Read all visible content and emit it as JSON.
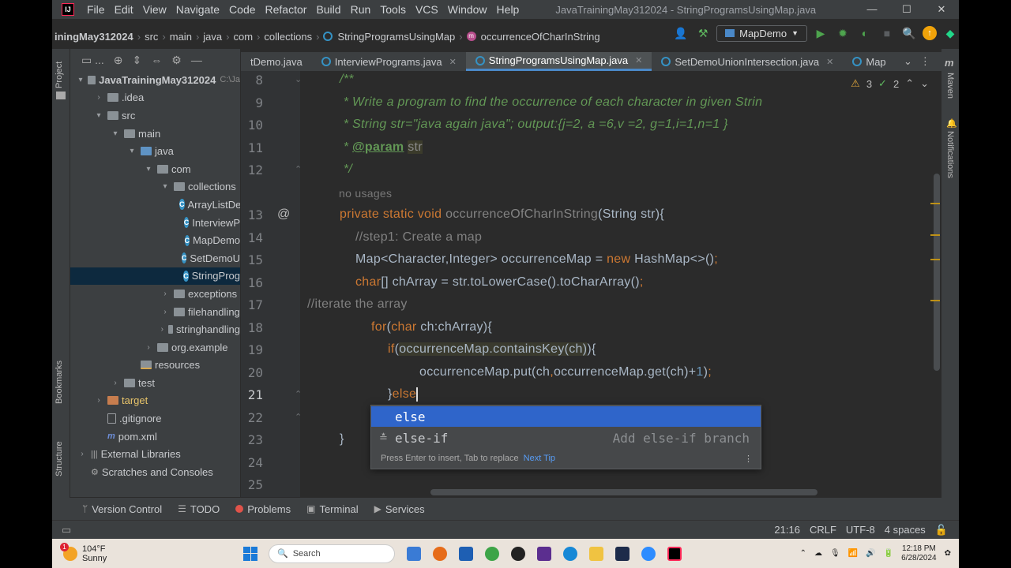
{
  "window": {
    "title": "JavaTrainingMay312024 - StringProgramsUsingMap.java",
    "menu": [
      "File",
      "Edit",
      "View",
      "Navigate",
      "Code",
      "Refactor",
      "Build",
      "Run",
      "Tools",
      "VCS",
      "Window",
      "Help"
    ],
    "controls": [
      "—",
      "☐",
      "✕"
    ]
  },
  "breadcrumb": [
    "iningMay312024",
    "src",
    "main",
    "java",
    "com",
    "collections",
    "StringProgramsUsingMap",
    "occurrenceOfCharInString"
  ],
  "run_config": "MapDemo",
  "tool_strip_left": [
    "Project",
    "Bookmarks",
    "Structure"
  ],
  "tool_strip_right": [
    "Maven",
    "Notifications"
  ],
  "project": {
    "toolbar_label": "...",
    "tree": [
      {
        "label": "JavaTrainingMay312024",
        "suffix": "C:\\Ja",
        "depth": 0,
        "chev": "▾",
        "icon": "folder"
      },
      {
        "label": ".idea",
        "depth": 1,
        "chev": "›",
        "icon": "folder"
      },
      {
        "label": "src",
        "depth": 1,
        "chev": "▾",
        "icon": "folder"
      },
      {
        "label": "main",
        "depth": 2,
        "chev": "▾",
        "icon": "folder"
      },
      {
        "label": "java",
        "depth": 3,
        "chev": "▾",
        "icon": "src"
      },
      {
        "label": "com",
        "depth": 4,
        "chev": "▾",
        "icon": "folder"
      },
      {
        "label": "collections",
        "depth": 5,
        "chev": "▾",
        "icon": "folder"
      },
      {
        "label": "ArrayListDe",
        "depth": 6,
        "chev": "",
        "icon": "class"
      },
      {
        "label": "InterviewP",
        "depth": 6,
        "chev": "",
        "icon": "class"
      },
      {
        "label": "MapDemo",
        "depth": 6,
        "chev": "",
        "icon": "class"
      },
      {
        "label": "SetDemoU",
        "depth": 6,
        "chev": "",
        "icon": "class"
      },
      {
        "label": "StringProg",
        "depth": 6,
        "chev": "",
        "icon": "class",
        "selected": true
      },
      {
        "label": "exceptions",
        "depth": 5,
        "chev": "›",
        "icon": "folder"
      },
      {
        "label": "filehandling",
        "depth": 5,
        "chev": "›",
        "icon": "folder"
      },
      {
        "label": "stringhandling",
        "depth": 5,
        "chev": "›",
        "icon": "folder"
      },
      {
        "label": "org.example",
        "depth": 4,
        "chev": "›",
        "icon": "folder"
      },
      {
        "label": "resources",
        "depth": 3,
        "chev": "",
        "icon": "res"
      },
      {
        "label": "test",
        "depth": 2,
        "chev": "›",
        "icon": "folder"
      },
      {
        "label": "target",
        "depth": 1,
        "chev": "›",
        "icon": "target",
        "hl": true
      },
      {
        "label": ".gitignore",
        "depth": 1,
        "chev": "",
        "icon": "file"
      },
      {
        "label": "pom.xml",
        "depth": 1,
        "chev": "",
        "icon": "pom"
      },
      {
        "label": "External Libraries",
        "depth": 0,
        "chev": "›",
        "icon": "lib"
      },
      {
        "label": "Scratches and Consoles",
        "depth": 0,
        "chev": "",
        "icon": "scratch"
      }
    ]
  },
  "tabs": [
    {
      "label": "tDemo.java",
      "active": false
    },
    {
      "label": "InterviewPrograms.java",
      "active": false
    },
    {
      "label": "StringProgramsUsingMap.java",
      "active": true
    },
    {
      "label": "SetDemoUnionIntersection.java",
      "active": false
    },
    {
      "label": "Map",
      "active": false
    }
  ],
  "inspections": {
    "warnings": "3",
    "weak": "2"
  },
  "line_numbers": [
    "8",
    "9",
    "10",
    "11",
    "12",
    "13",
    "14",
    "15",
    "16",
    "17",
    "18",
    "19",
    "20",
    "21",
    "22",
    "23",
    "24",
    "25"
  ],
  "code": {
    "l8": "/**",
    "l9": " * Write a program to find the occurrence of each character in given Strin",
    "l10": " * String str=\"java again java\"; output:{j=2, a =6,v =2, g=1,i=1,n=1 }",
    "l11_star": " * ",
    "l11_tag": "@param",
    "l11_param": "str",
    "l12": " */",
    "hint_usages": "no usages",
    "l13_kw": "private static void ",
    "l13_fn": "occurrenceOfCharInString",
    "l13_rest": "(String str){",
    "l14": "//step1: Create a map",
    "l15_a": "Map<Character,Integer> occurrenceMap = ",
    "l15_kw": "new",
    "l15_b": " HashMap<>()",
    "l15_semi": ";",
    "l16_kw": "char",
    "l16_rest": "[] chArray = str.toLowerCase().toCharArray()",
    "l16_semi": ";",
    "l17": "//iterate the array",
    "l18_kw": "for",
    "l18_a": "(",
    "l18_kw2": "char",
    "l18_b": " ch:chArray){",
    "l19_kw": "if",
    "l19_a": "(",
    "l19_hl": "occurrenceMap.containsKey(ch)",
    "l19_b": "){",
    "l20_a": "occurrenceMap.put(ch",
    "l20_comma": ",",
    "l20_b": "occurrenceMap.get(ch)+",
    "l20_num": "1",
    "l20_c": ")",
    "l20_semi": ";",
    "l21_a": "}",
    "l21_kw": "else",
    "l23": "}"
  },
  "completion": {
    "items": [
      {
        "label": "else",
        "hint": "",
        "selected": true
      },
      {
        "label": "else-if",
        "hint": "Add else-if branch",
        "selected": false
      }
    ],
    "footer": "Press Enter to insert, Tab to replace",
    "footer_link": "Next Tip"
  },
  "bottom_tools": [
    "Version Control",
    "TODO",
    "Problems",
    "Terminal",
    "Services"
  ],
  "status": {
    "position": "21:16",
    "line_sep": "CRLF",
    "encoding": "UTF-8",
    "indent": "4 spaces"
  },
  "taskbar": {
    "weather_temp": "104°F",
    "weather_desc": "Sunny",
    "weather_badge": "1",
    "search_placeholder": "Search",
    "time": "12:18 PM",
    "date": "6/28/2024"
  }
}
